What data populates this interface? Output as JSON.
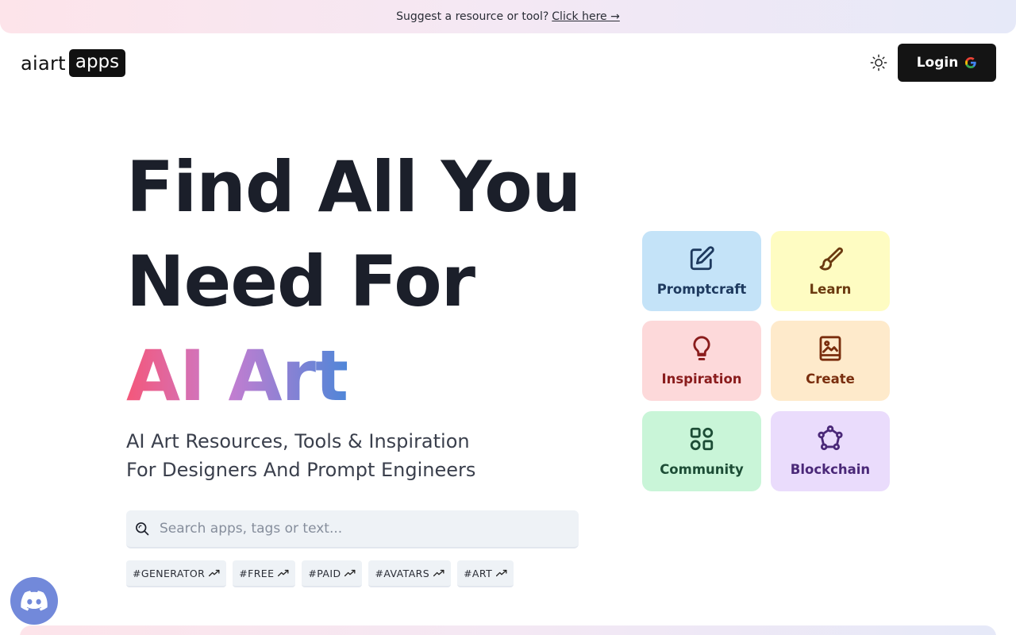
{
  "banner": {
    "text": "Suggest a resource or tool?",
    "link": "Click here →"
  },
  "logo": {
    "left": "aiart",
    "right": "apps"
  },
  "header": {
    "theme_icon": "sun-icon",
    "login_label": "Login",
    "login_icon": "google-icon"
  },
  "hero": {
    "line1": "Find All You",
    "line2": "Need For",
    "line3": "AI Art",
    "subtitle_line1": "AI Art Resources, Tools & Inspiration",
    "subtitle_line2": "For Designers And Prompt Engineers"
  },
  "search": {
    "placeholder": "Search apps, tags or text...",
    "value": "",
    "icon": "search-icon"
  },
  "tags": [
    {
      "label": "#GENERATOR"
    },
    {
      "label": "#FREE"
    },
    {
      "label": "#PAID"
    },
    {
      "label": "#AVATARS"
    },
    {
      "label": "#ART"
    }
  ],
  "categories": [
    {
      "label": "Promptcraft",
      "icon": "edit-icon",
      "bg": "#c4e3f8",
      "fg": "#1e3a5f"
    },
    {
      "label": "Learn",
      "icon": "paintbrush-icon",
      "bg": "#fefcc2",
      "fg": "#6b3a10"
    },
    {
      "label": "Inspiration",
      "icon": "lightbulb-icon",
      "bg": "#fdd9da",
      "fg": "#8a1c1c"
    },
    {
      "label": "Create",
      "icon": "image-icon",
      "bg": "#feeacb",
      "fg": "#7a2e0e"
    },
    {
      "label": "Community",
      "icon": "grid-icon",
      "bg": "#c9f5d8",
      "fg": "#1d4d36"
    },
    {
      "label": "Blockchain",
      "icon": "network-icon",
      "bg": "#eadcfc",
      "fg": "#4a2878"
    }
  ],
  "discord": {
    "icon": "discord-icon",
    "bg": "#7289da"
  },
  "colors": {
    "dark": "#141414",
    "heading": "#1b1f2a",
    "gradient": [
      "#f4577a",
      "#c77dd0",
      "#4f86d8"
    ]
  }
}
